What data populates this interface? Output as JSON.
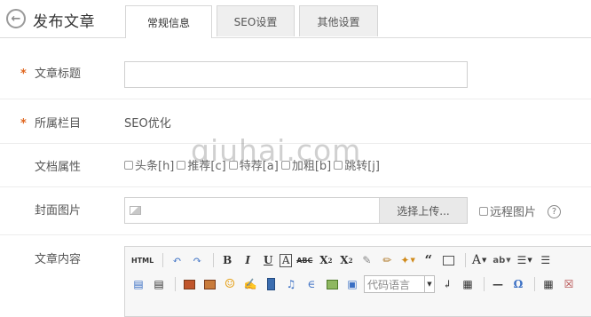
{
  "header": {
    "title": "发布文章",
    "back_icon": "back-arrow-icon",
    "tabs": [
      {
        "label": "常规信息",
        "active": true
      },
      {
        "label": "SEO设置",
        "active": false
      },
      {
        "label": "其他设置",
        "active": false
      }
    ]
  },
  "form": {
    "title_label": "文章标题",
    "title_value": "",
    "column_label": "所属栏目",
    "column_value": "SEO优化",
    "attr_label": "文档属性",
    "attributes": [
      "头条[h]",
      "推荐[c]",
      "特荐[a]",
      "加粗[b]",
      "跳转[j]"
    ],
    "cover_label": "封面图片",
    "cover_value": "",
    "upload_label": "选择上传...",
    "remote_label": "远程图片",
    "help_icon": "?",
    "content_label": "文章内容",
    "required_mark": "*"
  },
  "editor": {
    "code_language_placeholder": "代码语言",
    "toolbar_row1": [
      "HTML",
      "undo",
      "redo",
      "B",
      "I",
      "U",
      "A",
      "ABC",
      "X²",
      "X₂",
      "eraser",
      "brush",
      "magic",
      "66",
      "paste",
      "A",
      "ab",
      "list",
      "list2"
    ],
    "toolbar_row2": [
      "align-left",
      "align-center",
      "image",
      "image-multi",
      "emoji",
      "scrawl",
      "video",
      "music",
      "attachment",
      "map",
      "code-insert",
      "代码语言",
      "line-break",
      "insert-frame",
      "hr",
      "Ω",
      "table",
      "table-x"
    ]
  },
  "watermark": "qiuhai.com",
  "colors": {
    "required_star": "#e0661f",
    "border": "#cfcfcf",
    "tab_bg": "#efefef"
  }
}
